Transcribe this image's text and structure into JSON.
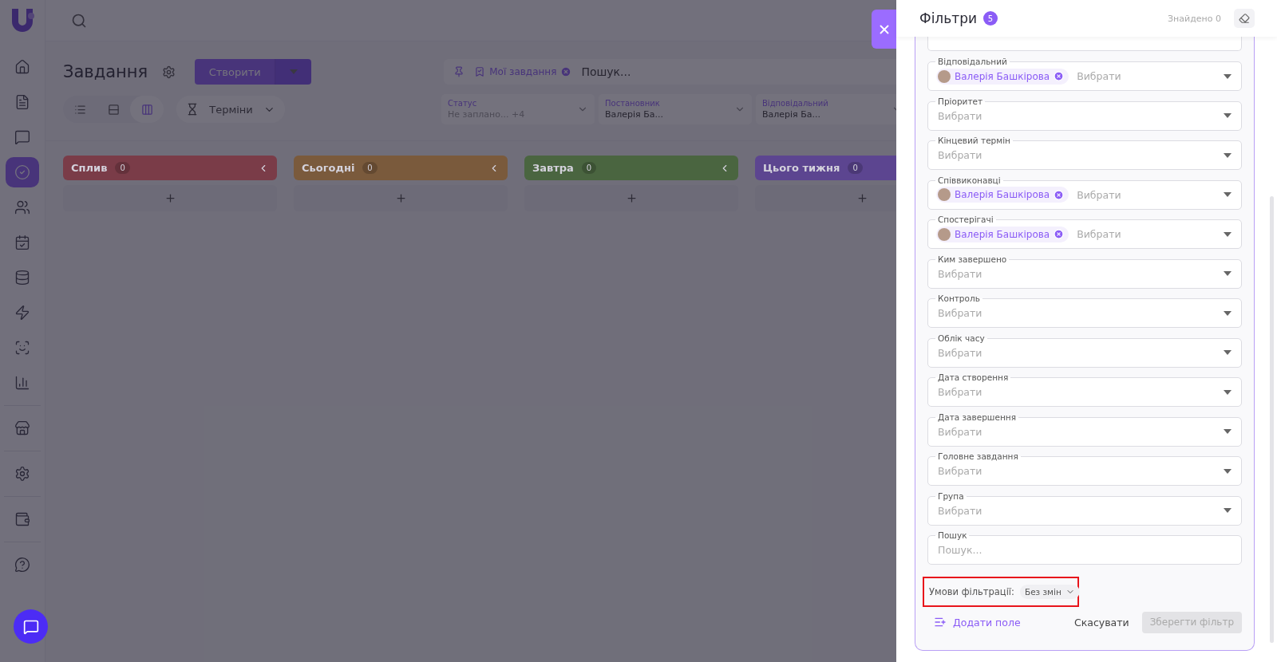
{
  "sidebar": {
    "items": [
      {
        "selected": false
      },
      {
        "selected": false
      },
      {
        "selected": false
      },
      {
        "selected": true
      },
      {
        "selected": false
      },
      {
        "selected": false
      },
      {
        "selected": false
      },
      {
        "selected": false
      },
      {
        "selected": false
      },
      {
        "selected": false
      },
      {
        "selected": false
      },
      {
        "selected": false
      },
      {
        "selected": false
      },
      {
        "selected": false
      }
    ]
  },
  "page": {
    "title": "Завдання",
    "create_button": "Створити",
    "view_modes": [
      {
        "selected": false
      },
      {
        "selected": false
      },
      {
        "selected": true
      }
    ],
    "grouping": "Терміни",
    "quick_filter": {
      "chip": "Мої завдання",
      "placeholder": "Пошук..."
    },
    "filters": [
      {
        "label": "Статус",
        "value": "Не заплано...",
        "extra": "+4",
        "muted": true
      },
      {
        "label": "Постановник",
        "value": "Валерія Ба...",
        "muted": false
      },
      {
        "label": "Відповідальний",
        "value": "Валерія Ба...",
        "muted": false
      }
    ]
  },
  "columns": [
    {
      "title": "Сплив",
      "count": "0",
      "color": "#7a3c48"
    },
    {
      "title": "Сьогодні",
      "count": "0",
      "color": "#7a5a3c"
    },
    {
      "title": "Завтра",
      "count": "0",
      "color": "#4a6540"
    },
    {
      "title": "Цього тижня",
      "count": "0",
      "color": "#5c4590"
    }
  ],
  "drawer": {
    "title": "Фільтри",
    "badge": "5",
    "found": "Знайдено 0",
    "fields": [
      {
        "kind": "select",
        "label": "Відповідальний",
        "chips": [
          "Валерія Башкірова"
        ],
        "placeholder": "Вибрати"
      },
      {
        "kind": "select",
        "label": "Пріоритет",
        "placeholder": "Вибрати"
      },
      {
        "kind": "select",
        "label": "Кінцевий термін",
        "placeholder": "Вибрати"
      },
      {
        "kind": "select",
        "label": "Співвиконавці",
        "chips": [
          "Валерія Башкірова"
        ],
        "placeholder": "Вибрати"
      },
      {
        "kind": "select",
        "label": "Спостерігачі",
        "chips": [
          "Валерія Башкірова"
        ],
        "placeholder": "Вибрати"
      },
      {
        "kind": "select",
        "label": "Ким завершено",
        "placeholder": "Вибрати"
      },
      {
        "kind": "select",
        "label": "Контроль",
        "placeholder": "Вибрати"
      },
      {
        "kind": "select",
        "label": "Облік часу",
        "placeholder": "Вибрати"
      },
      {
        "kind": "select",
        "label": "Дата створення",
        "placeholder": "Вибрати"
      },
      {
        "kind": "select",
        "label": "Дата завершення",
        "placeholder": "Вибрати"
      },
      {
        "kind": "select",
        "label": "Головне завдання",
        "placeholder": "Вибрати"
      },
      {
        "kind": "select",
        "label": "Група",
        "placeholder": "Вибрати"
      },
      {
        "kind": "text",
        "label": "Пошук",
        "placeholder": "Пошук..."
      }
    ],
    "conditions": {
      "label": "Умови фільтрації:",
      "value": "Без змін",
      "highlighted": true
    },
    "add_field": "Додати поле",
    "cancel": "Скасувати",
    "save": {
      "label": "Зберегти фільтр",
      "disabled": true
    }
  }
}
